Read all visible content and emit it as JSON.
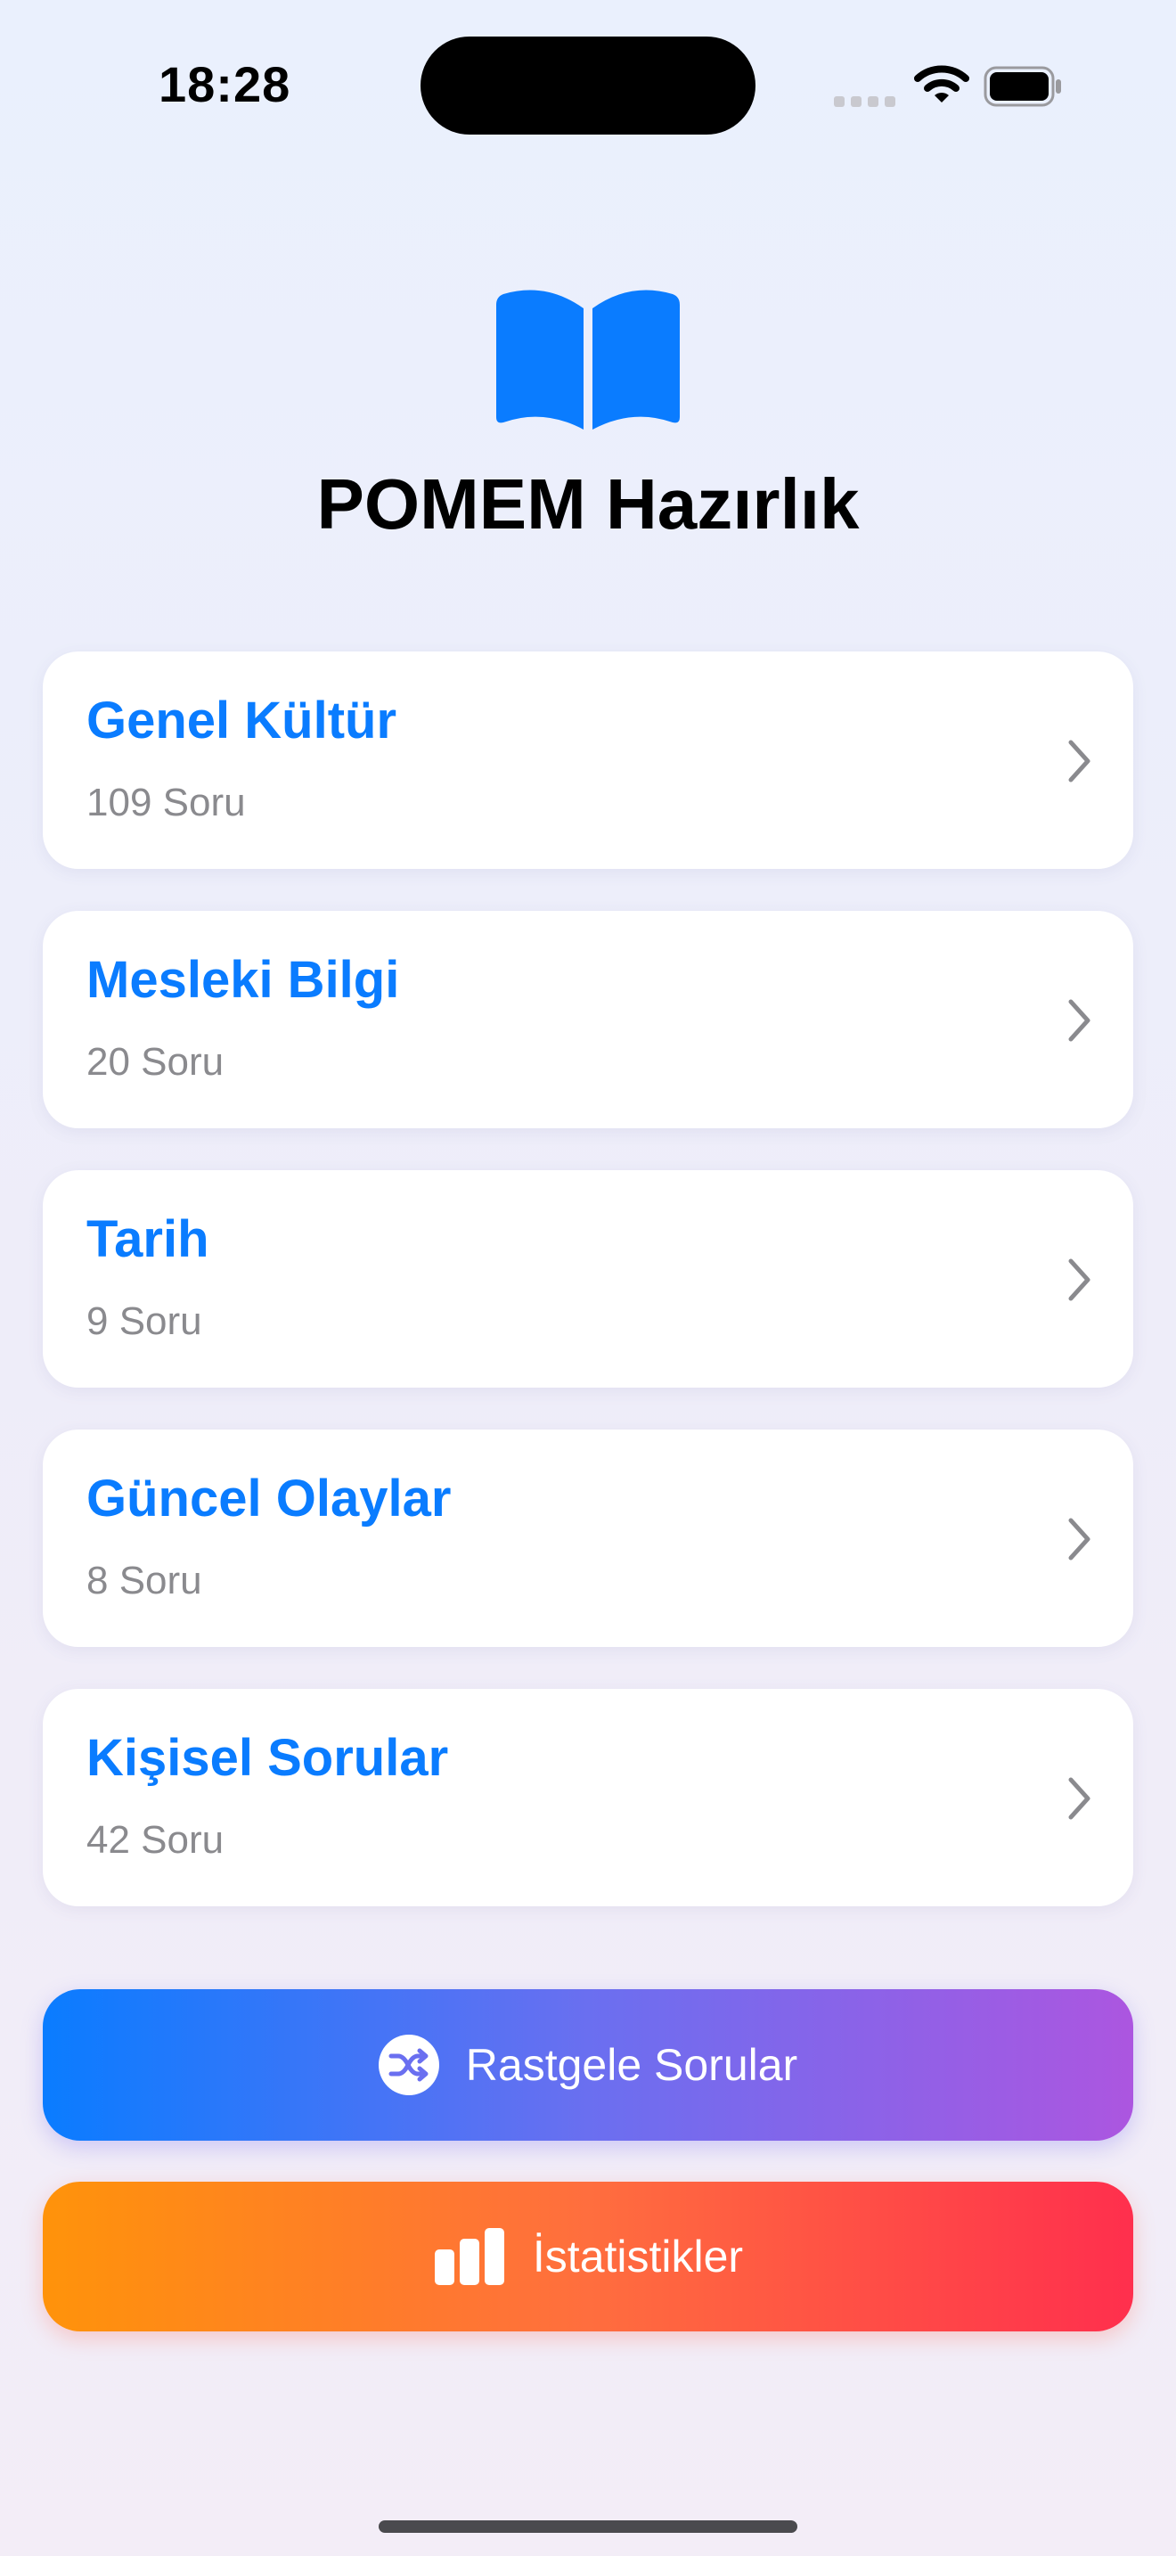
{
  "status_bar": {
    "time": "18:28",
    "icons": [
      "cellular-signal-icon",
      "wifi-icon",
      "battery-icon"
    ]
  },
  "header": {
    "icon": "open-book-icon",
    "title": "POMEM Hazırlık"
  },
  "categories": [
    {
      "title": "Genel Kültür",
      "count": "109 Soru"
    },
    {
      "title": "Mesleki Bilgi",
      "count": "20 Soru"
    },
    {
      "title": "Tarih",
      "count": "9 Soru"
    },
    {
      "title": "Güncel Olaylar",
      "count": "8 Soru"
    },
    {
      "title": "Kişisel Sorular",
      "count": "42 Soru"
    }
  ],
  "actions": {
    "random": {
      "label": "Rastgele Sorular",
      "icon": "shuffle-icon"
    },
    "stats": {
      "label": "İstatistikler",
      "icon": "bar-chart-icon"
    }
  },
  "colors": {
    "accent": "#0a7cff",
    "secondary_text": "#8a8a8e",
    "random_gradient": [
      "#0a7cff",
      "#ac56e0"
    ],
    "stats_gradient": [
      "#ff930a",
      "#ff2f4d"
    ]
  }
}
